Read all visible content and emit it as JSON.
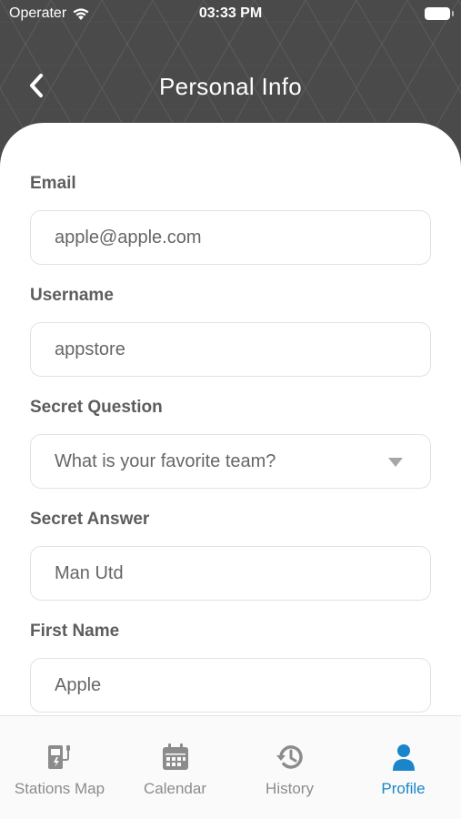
{
  "status_bar": {
    "carrier": "Operater",
    "time": "03:33 PM"
  },
  "header": {
    "title": "Personal Info"
  },
  "form": {
    "email": {
      "label": "Email",
      "value": "apple@apple.com"
    },
    "username": {
      "label": "Username",
      "value": "appstore"
    },
    "secret_question": {
      "label": "Secret Question",
      "value": "What is your favorite team?"
    },
    "secret_answer": {
      "label": "Secret Answer",
      "value": "Man Utd"
    },
    "first_name": {
      "label": "First Name",
      "value": "Apple"
    }
  },
  "tabs": [
    {
      "label": "Stations Map",
      "icon": "charging-station-icon",
      "active": false
    },
    {
      "label": "Calendar",
      "icon": "calendar-icon",
      "active": false
    },
    {
      "label": "History",
      "icon": "history-icon",
      "active": false
    },
    {
      "label": "Profile",
      "icon": "user-icon",
      "active": true
    }
  ],
  "colors": {
    "accent": "#1a85c8",
    "header": "#4a4a4a",
    "label": "#5d5d5d"
  }
}
